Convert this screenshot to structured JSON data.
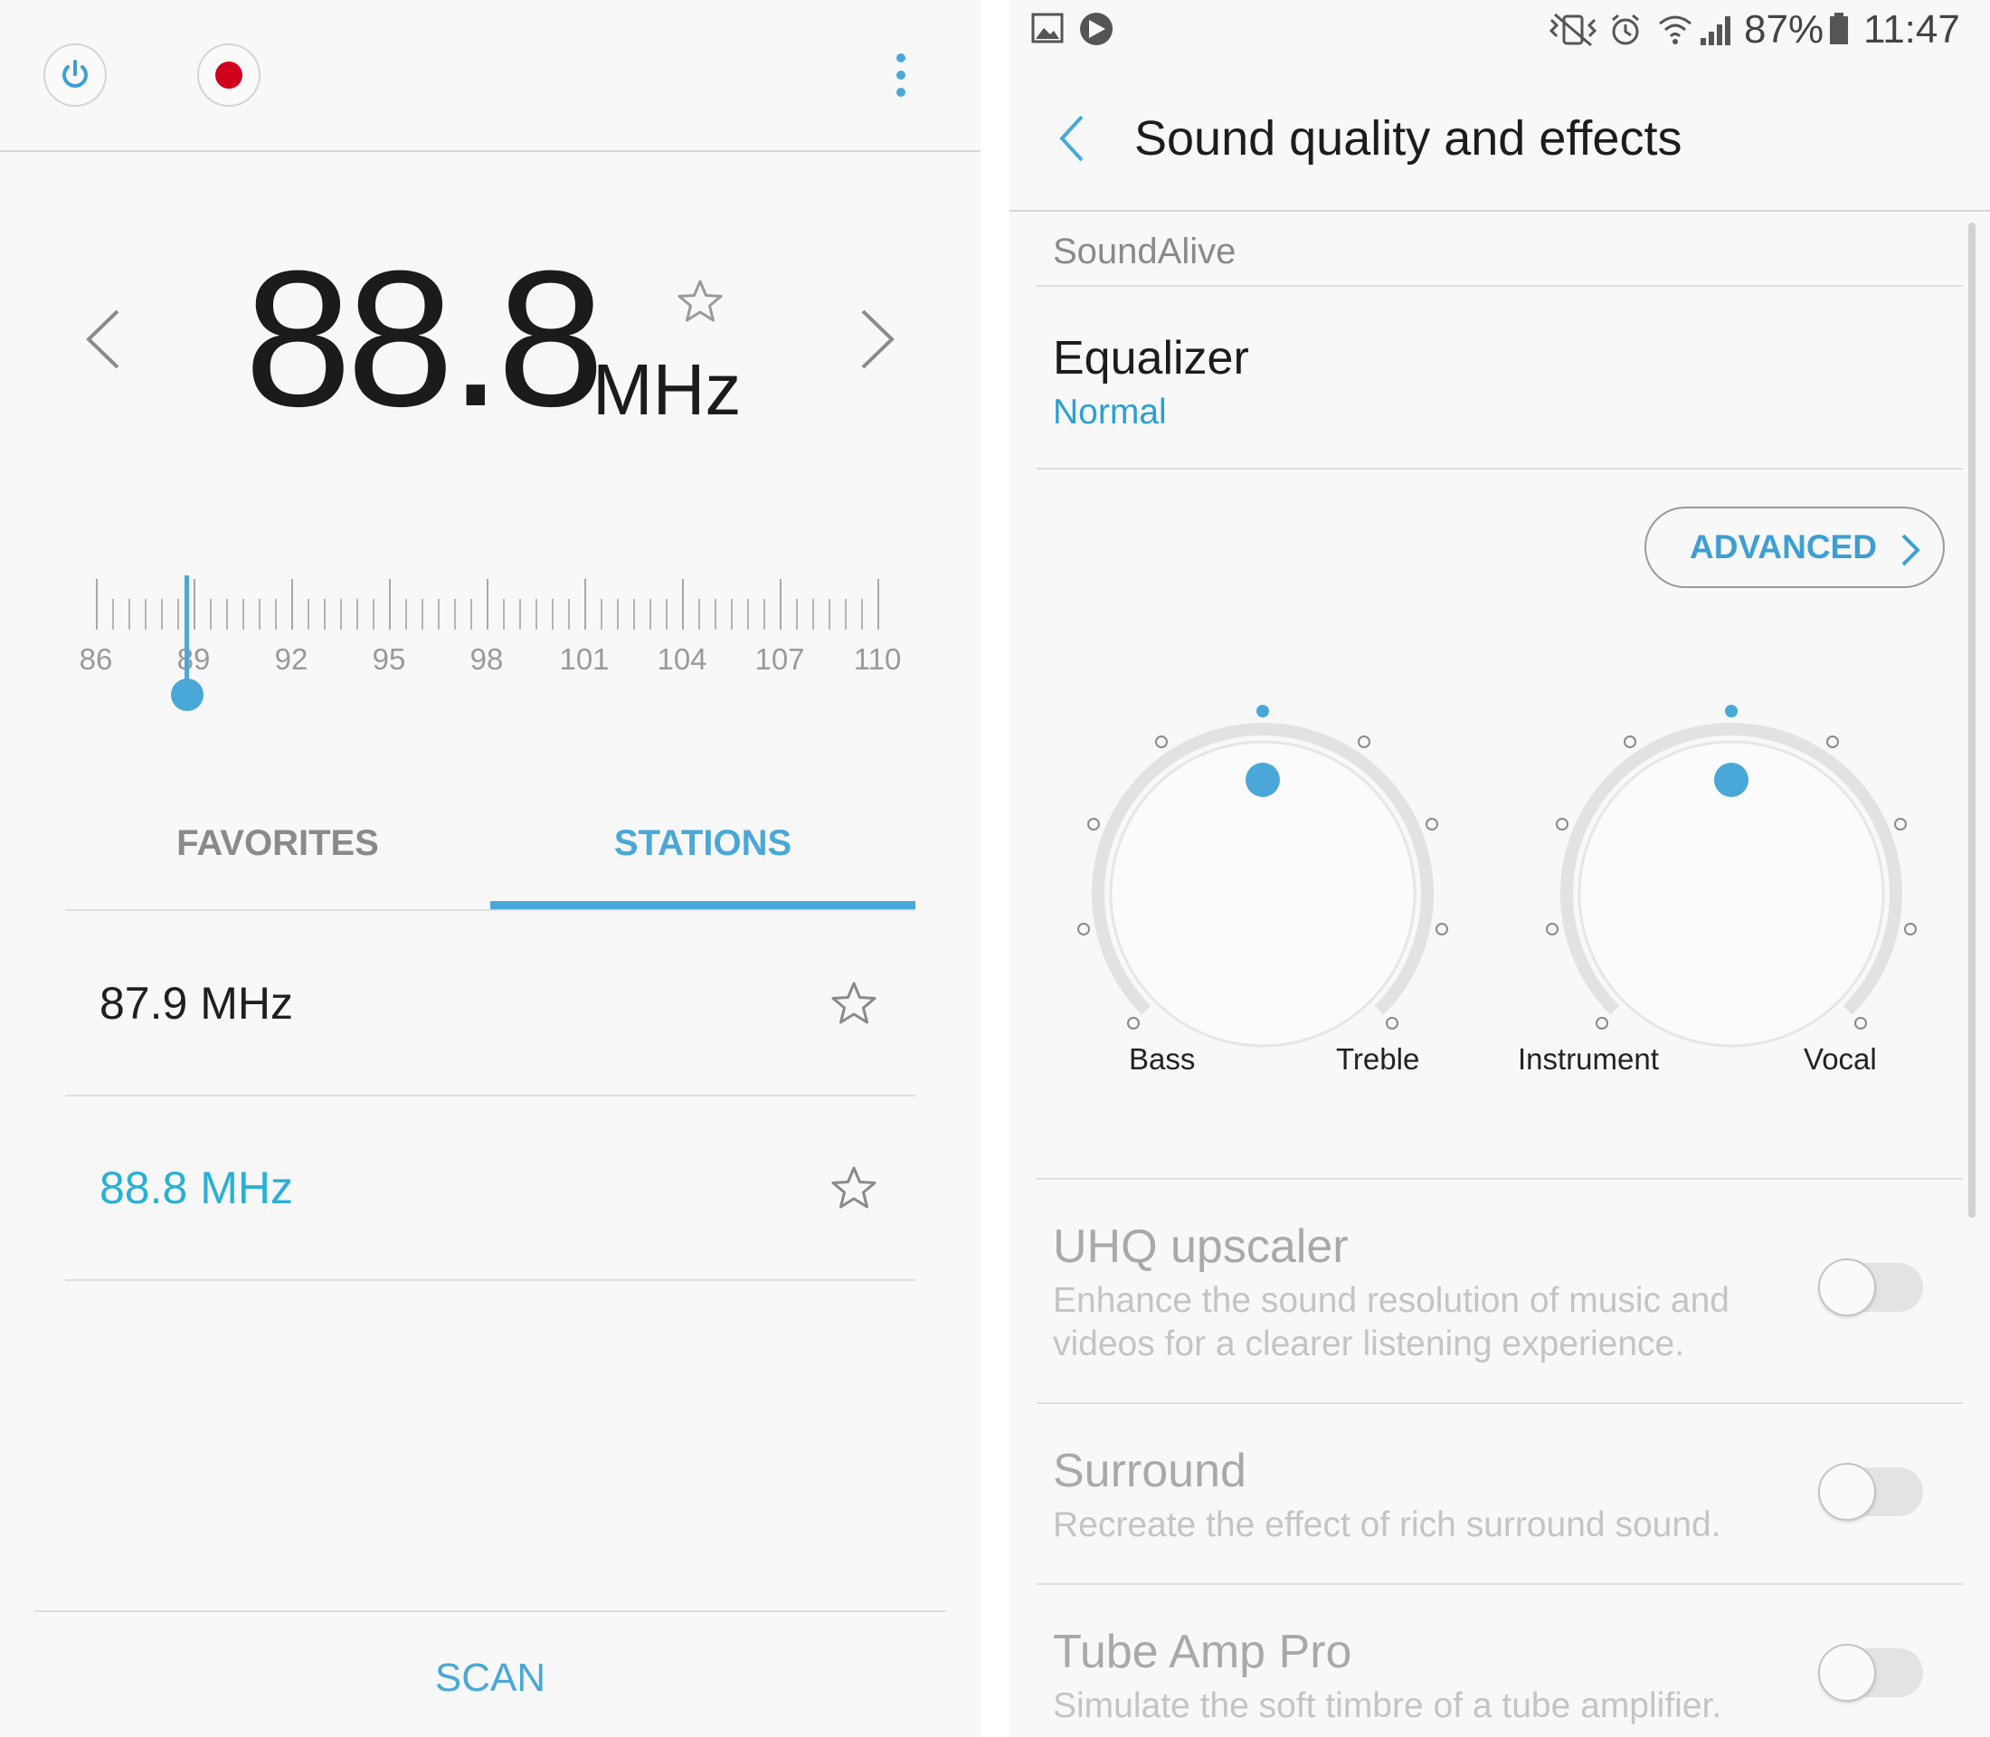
{
  "radio": {
    "frequency_whole": "88",
    "frequency_decimal": ".8",
    "unit": "MHz",
    "scale_labels": [
      "86",
      "89",
      "92",
      "95",
      "98",
      "101",
      "104",
      "107",
      "110"
    ],
    "tuned_value_mhz": 88.8,
    "scale_range_mhz": [
      86,
      110
    ],
    "tabs": [
      {
        "label": "FAVORITES",
        "active": false
      },
      {
        "label": "STATIONS",
        "active": true
      }
    ],
    "stations": [
      {
        "label": "87.9 MHz",
        "active": false
      },
      {
        "label": "88.8 MHz",
        "active": true
      }
    ],
    "scan_label": "SCAN"
  },
  "status_bar": {
    "battery": "87%",
    "time": "11:47",
    "icons": [
      "gallery-icon",
      "media-play-icon",
      "vibrate-mute-icon",
      "alarm-icon",
      "wifi-icon",
      "signal-icon",
      "battery-icon"
    ]
  },
  "sound": {
    "title": "Sound quality and effects",
    "section": "SoundAlive",
    "equalizer_label": "Equalizer",
    "equalizer_value": "Normal",
    "advanced_label": "ADVANCED",
    "knobs": [
      {
        "left_label": "Bass",
        "right_label": "Treble"
      },
      {
        "left_label": "Instrument",
        "right_label": "Vocal"
      }
    ],
    "settings": [
      {
        "title": "UHQ upscaler",
        "desc1": "Enhance the sound resolution of music and",
        "desc2": "videos for a clearer listening experience.",
        "on": false
      },
      {
        "title": "Surround",
        "desc1": "Recreate the effect of rich surround sound.",
        "on": false
      },
      {
        "title": "Tube Amp Pro",
        "desc1": "Simulate the soft timbre of a tube amplifier.",
        "on": false
      }
    ]
  },
  "colors": {
    "accent": "#4aa8d8",
    "station_active": "#29b0d5",
    "record": "#d0021b"
  }
}
